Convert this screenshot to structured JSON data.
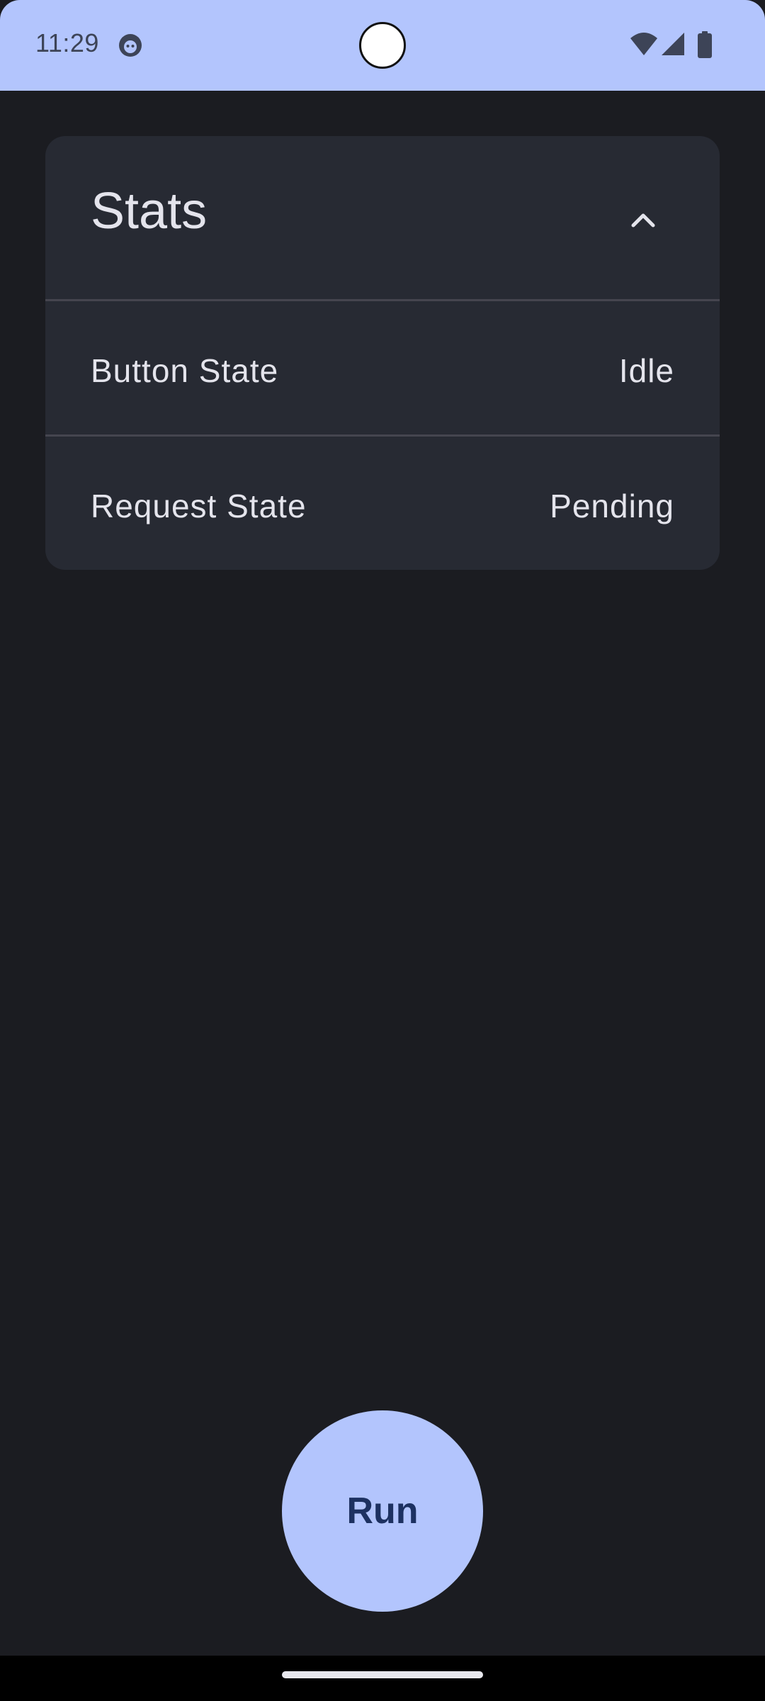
{
  "status_bar": {
    "time": "11:29",
    "background": "#b3c5fd",
    "icons": [
      "app-notification-icon",
      "wifi-icon",
      "signal-icon",
      "battery-icon"
    ]
  },
  "stats_card": {
    "title": "Stats",
    "expanded": true,
    "collapse_icon": "chevron-up-icon",
    "rows": [
      {
        "label": "Button State",
        "value": "Idle"
      },
      {
        "label": "Request State",
        "value": "Pending"
      }
    ]
  },
  "run_button": {
    "label": "Run",
    "background": "#b3c5fd",
    "text_color": "#1d3161"
  },
  "colors": {
    "screen_background": "#1b1c21",
    "card_background": "#272a33",
    "text_primary": "#e4e4ec",
    "divider": "#45454f"
  }
}
